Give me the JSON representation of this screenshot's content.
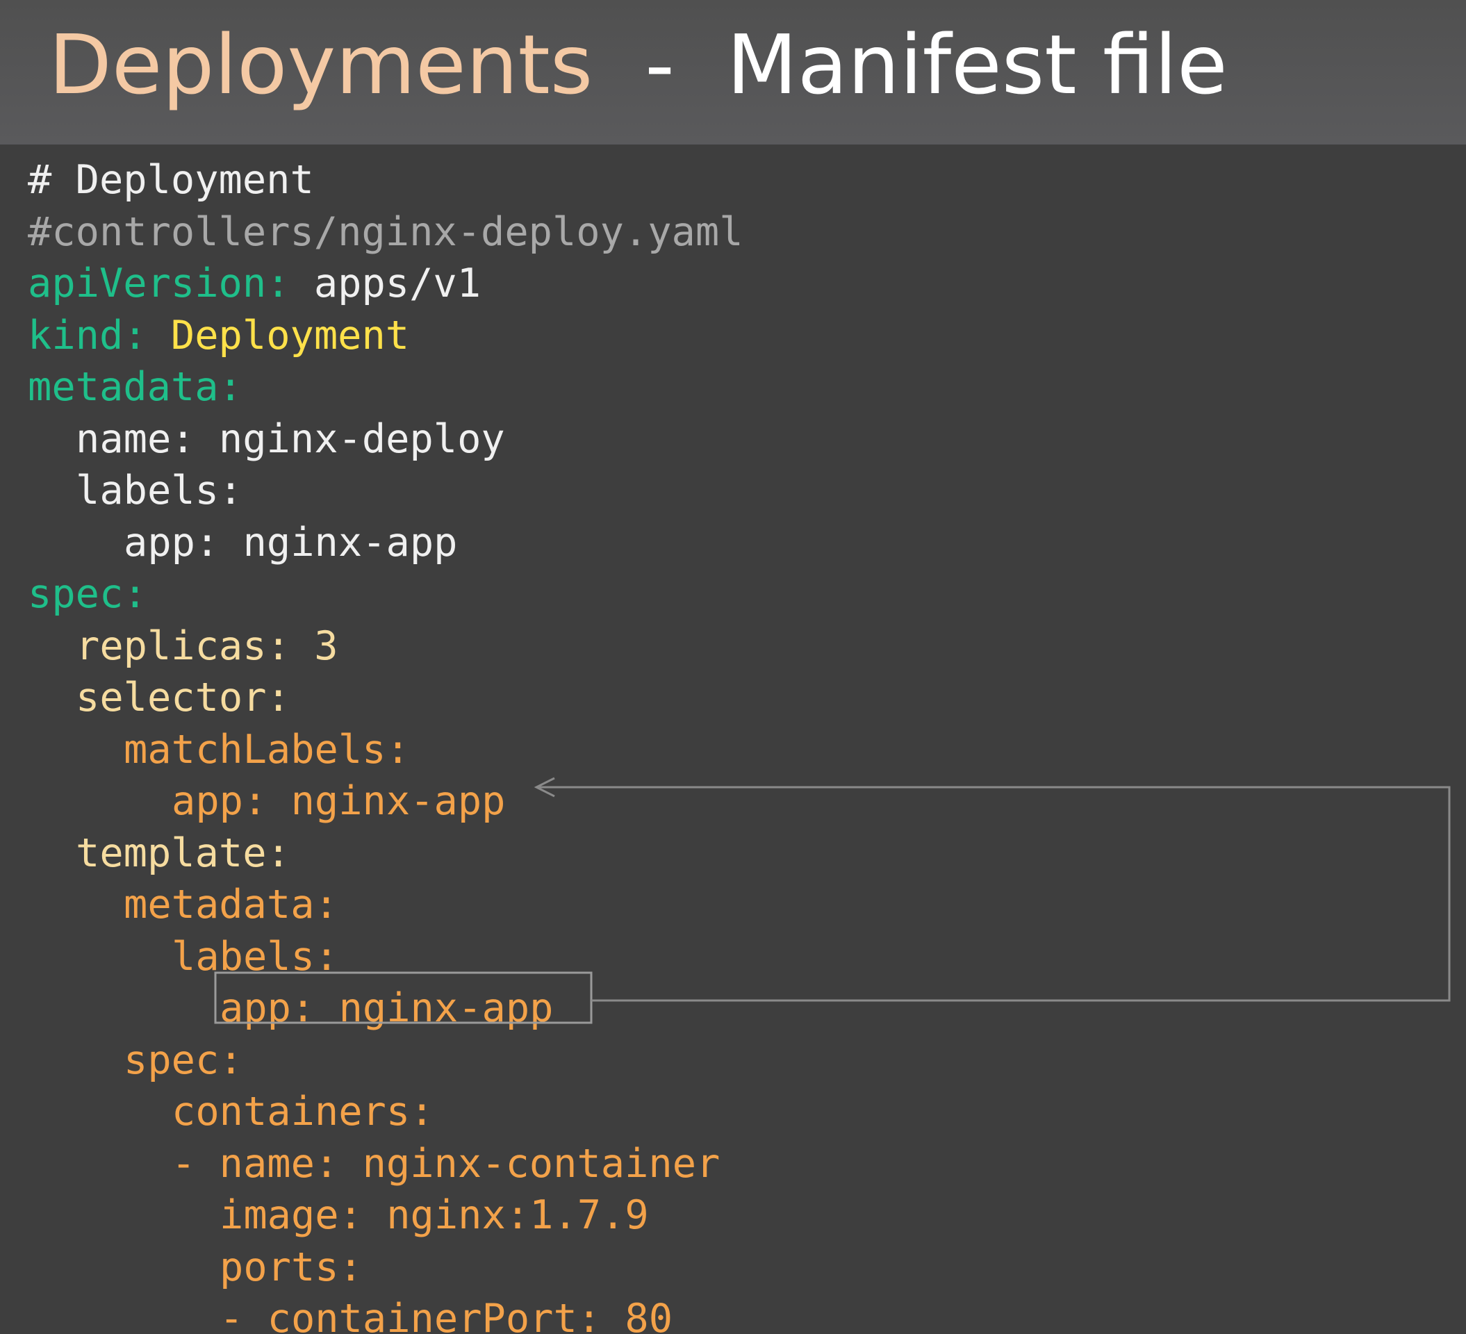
{
  "title": {
    "part1": "Deployments",
    "separator": "-",
    "part2": "Manifest file"
  },
  "code": {
    "comment_heading": "# Deployment",
    "comment_path": "#controllers/nginx-deploy.yaml",
    "api_key": "apiVersion:",
    "api_value": "apps/v1",
    "kind_key": "kind:",
    "kind_value": "Deployment",
    "metadata_key": "metadata:",
    "name_key": "name:",
    "name_value": "nginx-deploy",
    "labels_key": "labels:",
    "app_key": "app:",
    "app_value": "nginx-app",
    "spec_key": "spec:",
    "replicas_key": "replicas:",
    "replicas_value": "3",
    "selector_key": "selector:",
    "matchlabels_key": "matchLabels:",
    "match_app_key": "app:",
    "match_app_value": "nginx-app",
    "template_key": "template:",
    "tpl_metadata_key": "metadata:",
    "tpl_labels_key": "labels:",
    "tpl_app_key": "app:",
    "tpl_app_value": "nginx-app",
    "tpl_spec_key": "spec:",
    "containers_key": "containers:",
    "container_dash": "-",
    "container_name_key": "name:",
    "container_name_value": "nginx-container",
    "image_key": "image:",
    "image_value": "nginx:1.7.9",
    "ports_key": "ports:",
    "port_dash": "-",
    "container_port_key": "containerPort:",
    "container_port_value": "80"
  },
  "colors": {
    "background": "#3e3e3e",
    "header": "#555555",
    "title_accent": "#f4c9a4",
    "key_green": "#1fbf8a",
    "value_yellow": "#ffe14a",
    "spec_cream": "#f6dca0",
    "spec_orange": "#f3a24a",
    "connector_line": "#8a8a8a"
  }
}
